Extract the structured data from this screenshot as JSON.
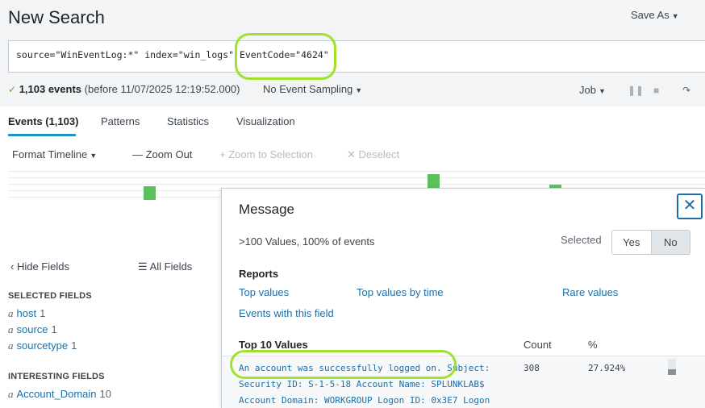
{
  "page_title": "New Search",
  "save_as_label": "Save As",
  "search_query": "source=\"WinEventLog:*\" index=\"win_logs\" EventCode=\"4624\"",
  "status": {
    "event_count": "1,103 events",
    "before_text": "(before 11/07/2025 12:19:52.000)",
    "sampling_label": "No Event Sampling",
    "job_label": "Job"
  },
  "tabs": [
    "Events (1,103)",
    "Patterns",
    "Statistics",
    "Visualization"
  ],
  "timeline": {
    "format_label": "Format Timeline",
    "zoom_out_label": "— Zoom Out",
    "zoom_selection_label": "+ Zoom to Selection",
    "deselect_label": "✕ Deselect"
  },
  "fields_sidebar": {
    "hide_fields_label": "Hide Fields",
    "all_fields_label": "All Fields",
    "selected_heading": "SELECTED FIELDS",
    "selected": [
      {
        "type": "a",
        "name": "host",
        "count": "1"
      },
      {
        "type": "a",
        "name": "source",
        "count": "1"
      },
      {
        "type": "a",
        "name": "sourcetype",
        "count": "1"
      }
    ],
    "interesting_heading": "INTERESTING FIELDS",
    "interesting": [
      {
        "type": "a",
        "name": "Account_Domain",
        "count": "10"
      }
    ]
  },
  "field_popup": {
    "title": "Message",
    "close_icon": "close-icon",
    "summary": ">100 Values, 100% of events",
    "selected_label": "Selected",
    "yes_label": "Yes",
    "no_label": "No",
    "reports_heading": "Reports",
    "report_links": {
      "top_values": "Top values",
      "top_values_by_time": "Top values by time",
      "rare_values": "Rare values",
      "events_with_field": "Events with this field"
    },
    "table_headers": {
      "value": "Top 10 Values",
      "count": "Count",
      "percent": "%"
    },
    "top_values": [
      {
        "value_lines": [
          "An account was successfully logged on. Subject:",
          "Security ID: S-1-5-18 Account Name: SPLUNKLAB$",
          "Account Domain: WORKGROUP Logon ID: 0x3E7 Logon"
        ],
        "count": "308",
        "percent": "27.924%",
        "fraction": 0.27924
      }
    ]
  },
  "colors": {
    "accent": "#1a6fa8",
    "timeline_bar": "#5cc05c",
    "highlight": "#9ee22b"
  }
}
